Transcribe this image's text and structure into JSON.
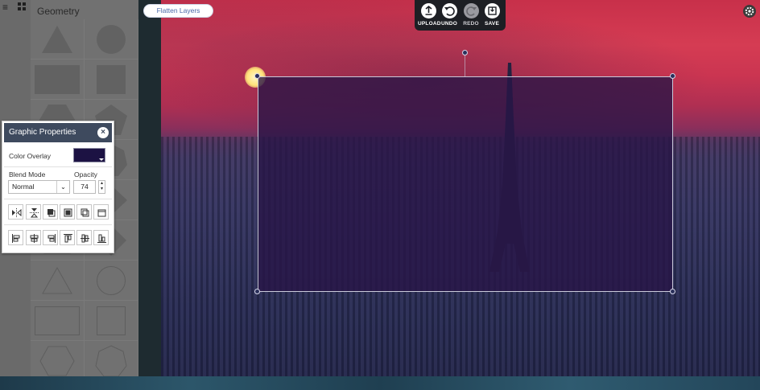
{
  "sidebar": {
    "panel_title": "Geometry",
    "menu_icon": "hamburger-menu-icon",
    "grid_icon": "grid-icon"
  },
  "toolbar": {
    "flatten_label": "Flatten Layers",
    "upload_label": "UPLOAD",
    "undo_label": "UNDO",
    "redo_label": "REDO",
    "save_label": "SAVE"
  },
  "properties": {
    "title": "Graphic Properties",
    "color_overlay_label": "Color Overlay",
    "color_overlay_value": "#1c1243",
    "blend_mode_label": "Blend Mode",
    "blend_mode_value": "Normal",
    "opacity_label": "Opacity",
    "opacity_value": "74"
  },
  "colors": {
    "accent": "#4a69a8",
    "panel_header": "#3e4a5e",
    "toolbar_bg": "#1d1f24"
  }
}
